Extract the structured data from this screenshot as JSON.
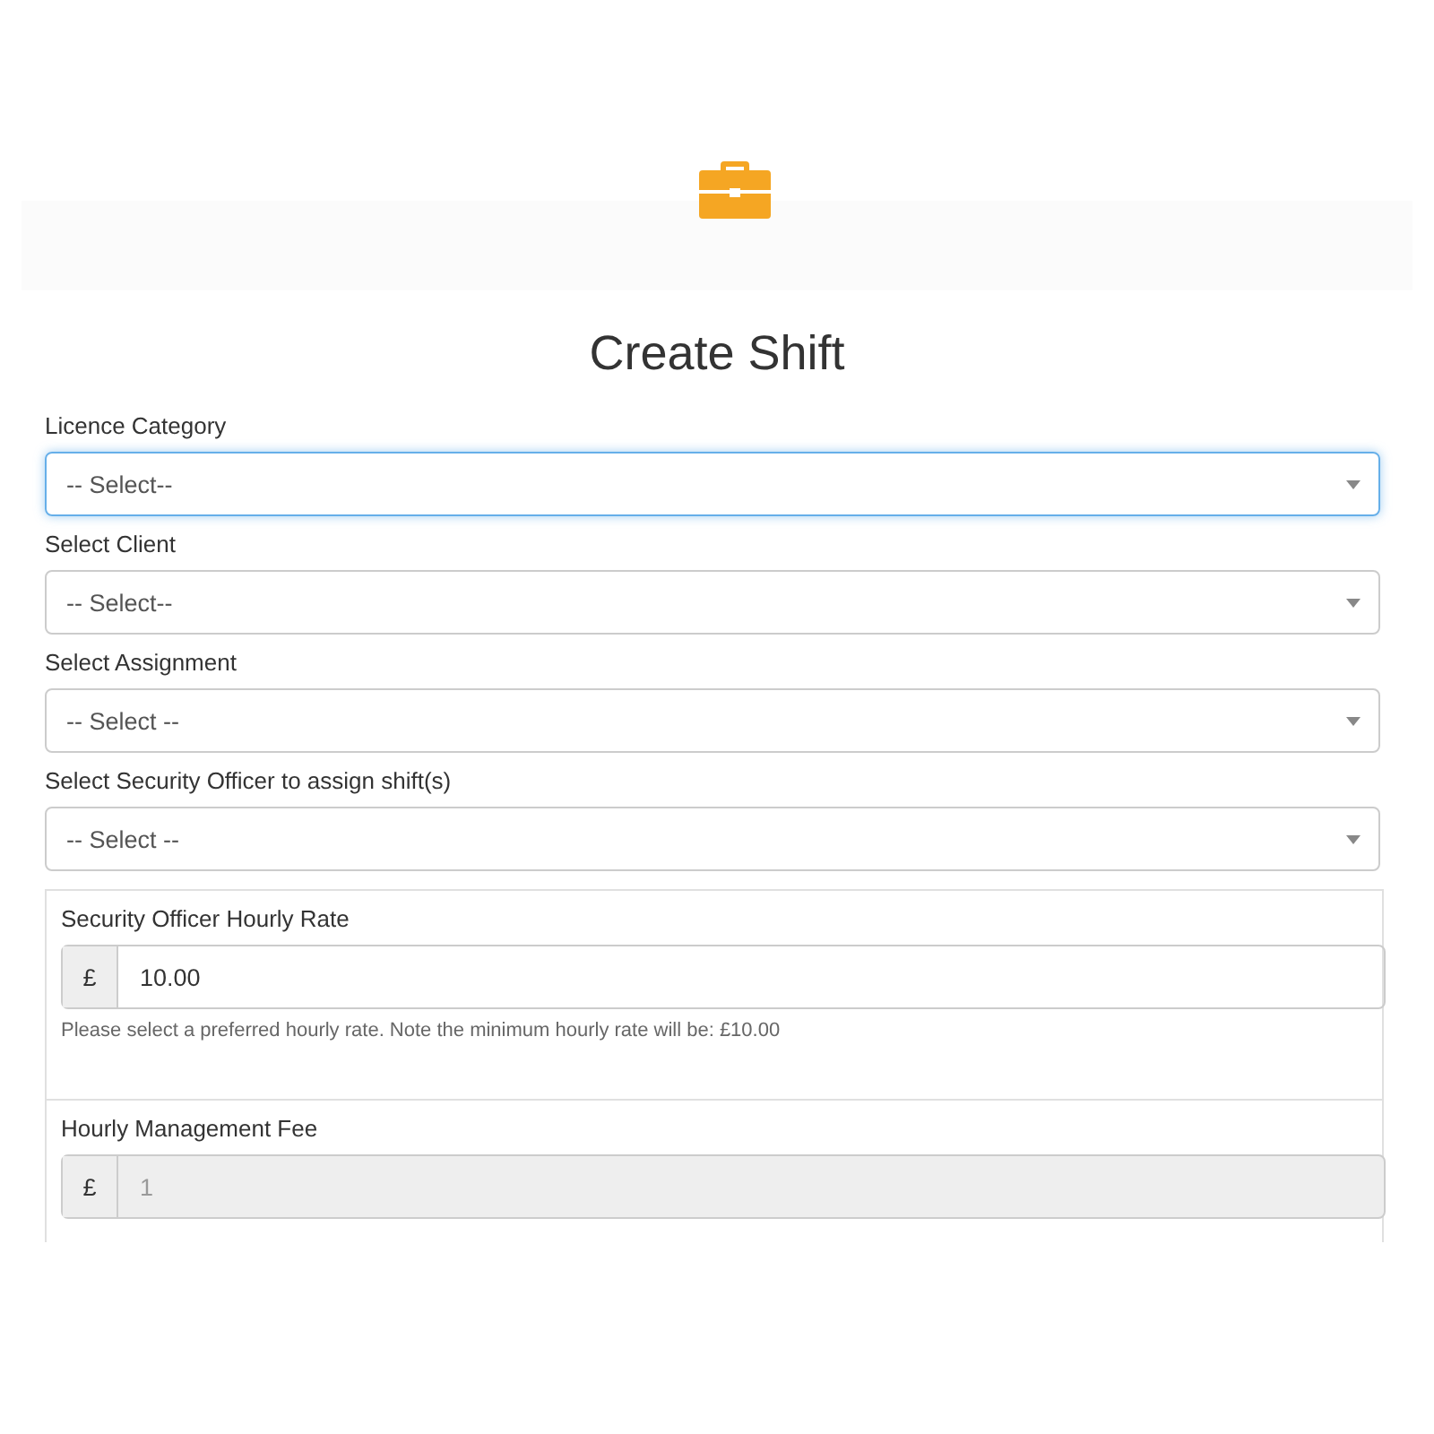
{
  "title": "Create Shift",
  "selects": [
    {
      "label": "Licence Category",
      "value": "-- Select--",
      "focused": true
    },
    {
      "label": "Select Client",
      "value": "-- Select--",
      "focused": false
    },
    {
      "label": "Select Assignment",
      "value": "-- Select --",
      "focused": false
    },
    {
      "label": "Select Security Officer to assign shift(s)",
      "value": "-- Select --",
      "focused": false
    }
  ],
  "rates": [
    {
      "label": "Security Officer Hourly Rate",
      "prefix": "£",
      "value": "10.00",
      "disabled": false,
      "help": "Please select a preferred hourly rate. Note the minimum hourly rate will be: £10.00"
    },
    {
      "label": "Hourly Management Fee",
      "prefix": "£",
      "value": "1",
      "disabled": true
    }
  ]
}
